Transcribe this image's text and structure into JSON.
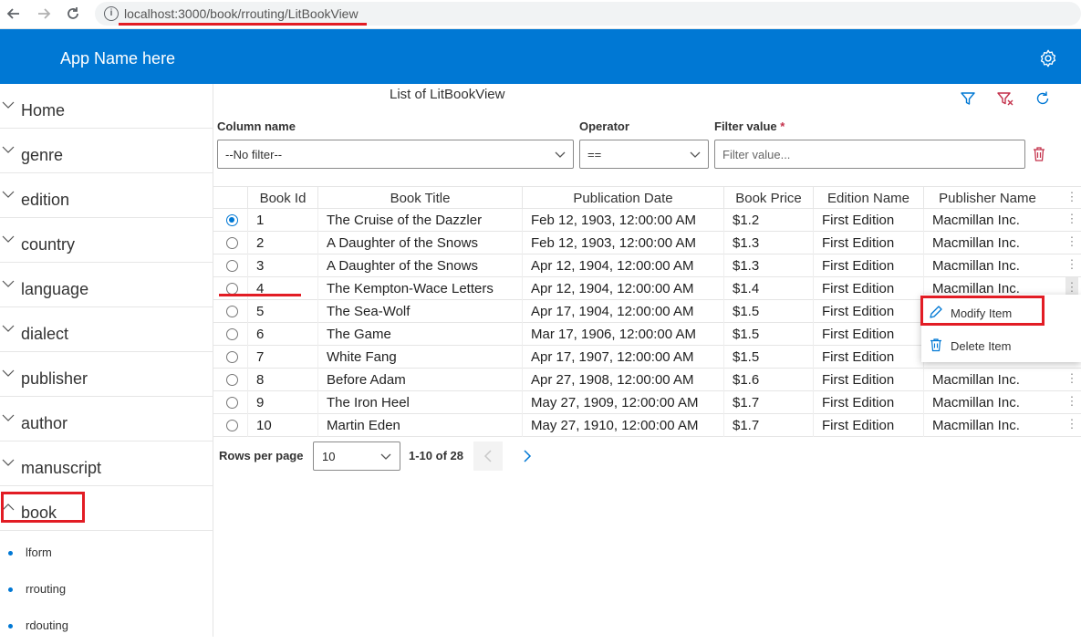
{
  "browser": {
    "url": "localhost:3000/book/rrouting/LitBookView",
    "back_icon": "arrow-left-icon",
    "forward_icon": "arrow-right-icon",
    "reload_icon": "reload-icon"
  },
  "app": {
    "title": "App Name here",
    "brand_color": "#0078d4",
    "settings_icon": "gear-icon"
  },
  "sidebar": {
    "items": [
      {
        "label": "Home",
        "expanded": false
      },
      {
        "label": "genre",
        "expanded": false
      },
      {
        "label": "edition",
        "expanded": false
      },
      {
        "label": "country",
        "expanded": false
      },
      {
        "label": "language",
        "expanded": false
      },
      {
        "label": "dialect",
        "expanded": false
      },
      {
        "label": "publisher",
        "expanded": false
      },
      {
        "label": "author",
        "expanded": false
      },
      {
        "label": "manuscript",
        "expanded": false
      },
      {
        "label": "book",
        "expanded": true
      }
    ],
    "sub_items": [
      {
        "label": "lform"
      },
      {
        "label": "rrouting",
        "highlighted": true
      },
      {
        "label": "rdouting"
      }
    ]
  },
  "main": {
    "title": "List of LitBookView",
    "toolbar": {
      "filter_icon": "filter-icon",
      "clear_filter_icon": "clear-filter-icon",
      "refresh_icon": "refresh-icon"
    },
    "filter": {
      "column_label": "Column name",
      "column_value": "--No filter--",
      "operator_label": "Operator",
      "operator_value": "==",
      "value_label": "Filter value",
      "required_mark": "*",
      "value_placeholder": "Filter value...",
      "delete_icon": "trash-icon"
    },
    "table": {
      "columns": [
        "Book Id",
        "Book Title",
        "Publication Date",
        "Book Price",
        "Edition Name",
        "Publisher Name"
      ],
      "selected_row": 0,
      "rows": [
        [
          "1",
          "The Cruise of the Dazzler",
          "Feb 12, 1903, 12:00:00 AM",
          "$1.2",
          "First Edition",
          "Macmillan Inc."
        ],
        [
          "2",
          "A Daughter of the Snows",
          "Feb 12, 1903, 12:00:00 AM",
          "$1.3",
          "First Edition",
          "Macmillan Inc."
        ],
        [
          "3",
          "A Daughter of the Snows",
          "Apr 12, 1904, 12:00:00 AM",
          "$1.3",
          "First Edition",
          "Macmillan Inc."
        ],
        [
          "4",
          "The Kempton-Wace Letters",
          "Apr 12, 1904, 12:00:00 AM",
          "$1.4",
          "First Edition",
          "Macmillan Inc."
        ],
        [
          "5",
          "The Sea-Wolf",
          "Apr 17, 1904, 12:00:00 AM",
          "$1.5",
          "First Edition",
          ""
        ],
        [
          "6",
          "The Game",
          "Mar 17, 1906, 12:00:00 AM",
          "$1.5",
          "First Edition",
          ""
        ],
        [
          "7",
          "White Fang",
          "Apr 17, 1907, 12:00:00 AM",
          "$1.5",
          "First Edition",
          ""
        ],
        [
          "8",
          "Before Adam",
          "Apr 27, 1908, 12:00:00 AM",
          "$1.6",
          "First Edition",
          "Macmillan Inc."
        ],
        [
          "9",
          "The Iron Heel",
          "May 27, 1909, 12:00:00 AM",
          "$1.7",
          "First Edition",
          "Macmillan Inc."
        ],
        [
          "10",
          "Martin Eden",
          "May 27, 1910, 12:00:00 AM",
          "$1.7",
          "First Edition",
          "Macmillan Inc."
        ]
      ]
    },
    "context_menu": {
      "modify_label": "Modify Item",
      "modify_icon": "pencil-icon",
      "delete_label": "Delete Item",
      "delete_icon": "trash-icon"
    },
    "pagination": {
      "rows_per_page_label": "Rows per page",
      "rows_per_page_value": "10",
      "range_label": "1-10 of 28",
      "prev_icon": "chevron-left-icon",
      "next_icon": "chevron-right-icon"
    }
  },
  "colors": {
    "accent": "#0078d4",
    "highlight_red": "#e21c24",
    "danger": "#c4314b"
  }
}
